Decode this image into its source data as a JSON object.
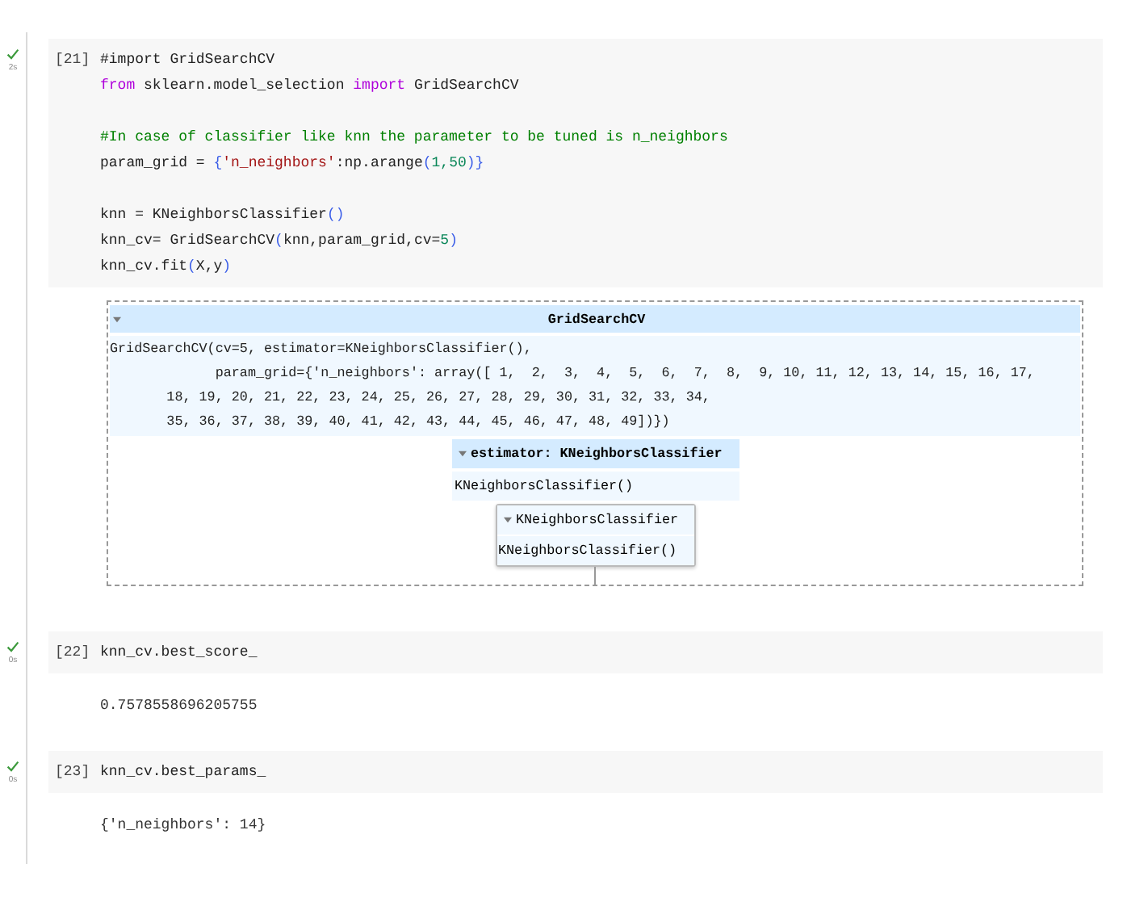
{
  "cells": [
    {
      "prompt": "[21]",
      "executed": true,
      "duration": "2s",
      "code": [
        {
          "kind": "code",
          "tokens": [
            {
              "kind": "plain",
              "text": "#import GridSearchCV"
            }
          ]
        },
        {
          "kind": "code",
          "tokens": [
            {
              "kind": "keyword",
              "text": "from"
            },
            {
              "kind": "plain",
              "text": " sklearn.model_selection "
            },
            {
              "kind": "keyword",
              "text": "import"
            },
            {
              "kind": "plain",
              "text": " GridSearchCV"
            }
          ]
        },
        {
          "kind": "blank"
        },
        {
          "kind": "code",
          "tokens": [
            {
              "kind": "comment",
              "text": "#In case of classifier like knn the parameter to be tuned is n_neighbors"
            }
          ]
        },
        {
          "kind": "code",
          "tokens": [
            {
              "kind": "plain",
              "text": "param_grid = "
            },
            {
              "kind": "bracket",
              "text": "{"
            },
            {
              "kind": "string",
              "text": "'n_neighbors'"
            },
            {
              "kind": "plain",
              "text": ":np.arange"
            },
            {
              "kind": "bracket",
              "text": "("
            },
            {
              "kind": "number",
              "text": "1,50"
            },
            {
              "kind": "bracket",
              "text": ")}"
            }
          ]
        },
        {
          "kind": "blank"
        },
        {
          "kind": "code",
          "tokens": [
            {
              "kind": "plain",
              "text": "knn = KNeighborsClassifier"
            },
            {
              "kind": "bracket",
              "text": "()"
            }
          ]
        },
        {
          "kind": "code",
          "tokens": [
            {
              "kind": "plain",
              "text": "knn_cv= GridSearchCV"
            },
            {
              "kind": "bracket",
              "text": "("
            },
            {
              "kind": "plain",
              "text": "knn,param_grid,cv="
            },
            {
              "kind": "number",
              "text": "5"
            },
            {
              "kind": "bracket",
              "text": ")"
            }
          ]
        },
        {
          "kind": "code",
          "tokens": [
            {
              "kind": "plain",
              "text": "knn_cv.fit"
            },
            {
              "kind": "bracket",
              "text": "("
            },
            {
              "kind": "plain",
              "text": "X,y"
            },
            {
              "kind": "bracket",
              "text": ")"
            }
          ]
        }
      ],
      "output": {
        "kind": "estimator",
        "title": "GridSearchCV",
        "repr": [
          "GridSearchCV(cv=5, estimator=KNeighborsClassifier(),",
          "             param_grid={'n_neighbors': array([ 1,  2,  3,  4,  5,  6,  7,  8,  9, 10, 11, 12, 13, 14, 15, 16, 17,",
          "       18, 19, 20, 21, 22, 23, 24, 25, 26, 27, 28, 29, 30, 31, 32, 33, 34,",
          "       35, 36, 37, 38, 39, 40, 41, 42, 43, 44, 45, 46, 47, 48, 49])})"
        ],
        "estimator": {
          "title": "estimator: KNeighborsClassifier",
          "repr": "KNeighborsClassifier()"
        },
        "inner": {
          "title": "KNeighborsClassifier",
          "repr": "KNeighborsClassifier()"
        }
      }
    },
    {
      "prompt": "[22]",
      "executed": true,
      "duration": "0s",
      "code": [
        {
          "kind": "code",
          "tokens": [
            {
              "kind": "plain",
              "text": "knn_cv.best_score_"
            }
          ]
        }
      ],
      "output": {
        "kind": "text",
        "text": "0.7578558696205755"
      }
    },
    {
      "prompt": "[23]",
      "executed": true,
      "duration": "0s",
      "code": [
        {
          "kind": "code",
          "tokens": [
            {
              "kind": "plain",
              "text": "knn_cv.best_params_"
            }
          ]
        }
      ],
      "output": {
        "kind": "text",
        "text": "{'n_neighbors': 14}"
      }
    }
  ]
}
